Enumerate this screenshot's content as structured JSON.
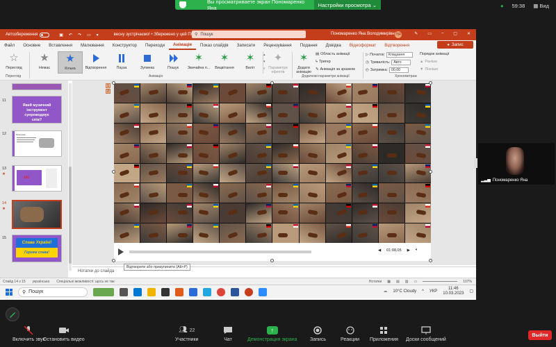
{
  "zoom": {
    "share_banner": "Вы просматриваете экран Пономаренко Яна",
    "view_options": "Настройки просмотра",
    "clock": "59:38",
    "view": "Вид",
    "participant_name": "Пономаренко Яна",
    "toolbar": {
      "mute": "Включить звук",
      "video": "Остановить видео",
      "participants": "Участники",
      "participants_count": "22",
      "chat": "Чат",
      "share": "Демонстрация экрана",
      "record": "Запись",
      "reactions": "Реакции",
      "apps": "Приложения",
      "whiteboards": "Доски сообщений",
      "leave": "Выйти"
    }
  },
  "ppt": {
    "autosave": "Автозбереження",
    "doc_title": "весну зустрічаємо! • Збережено у цей ПК",
    "search_placeholder": "Пошук",
    "user": "Пономаренко Яна Володимирівна",
    "initials": "ПЯ",
    "tabs": [
      "Файл",
      "Основне",
      "Вставлення",
      "Малювання",
      "Конструктор",
      "Переходи",
      "Анімація",
      "Показ слайдів",
      "Записати",
      "Рецензування",
      "Подання",
      "Довідка",
      "Відеоформат",
      "Відтворення"
    ],
    "share_btn": "Запис",
    "ribbon": {
      "preview": "Перегляд",
      "preview_group": "Перегляд",
      "animations": [
        {
          "label": "Немає",
          "kind": "none"
        },
        {
          "label": "Кілька",
          "kind": "sel"
        },
        {
          "label": "Відтворення",
          "kind": "play"
        },
        {
          "label": "Пауза",
          "kind": "pause"
        },
        {
          "label": "Зупинка",
          "kind": "stop"
        },
        {
          "label": "Пошук",
          "kind": "seek"
        },
        {
          "label": "Звичайна п...",
          "kind": "star"
        },
        {
          "label": "Вицвітання",
          "kind": "star"
        },
        {
          "label": "Виліт",
          "kind": "star"
        }
      ],
      "effect_params": "Параметри ефектів",
      "anim_group": "Анімація",
      "add_anim": "Додати анімацію",
      "anim_pane": "Область анімації",
      "trigger": "Тригер",
      "anim_painter": "Анімація за зразком",
      "adv_group": "Додаткові параметри анімації",
      "start_label": "Початок:",
      "start_val": "Клацання",
      "duration_label": "Тривалість:",
      "duration_val": "Авто",
      "delay_label": "Затримка:",
      "delay_val": "00,00",
      "reorder": "Порядок анімації",
      "earlier": "Раніше",
      "later": "Пізніше",
      "timing_group": "Хронометраж"
    },
    "slides": [
      {
        "num": "11",
        "text": "Який музичний інструмент супроводжує спів?"
      },
      {
        "num": "12",
        "text": "Пролунає..."
      },
      {
        "num": "13",
        "text": "141"
      },
      {
        "num": "14",
        "text": ""
      },
      {
        "num": "15",
        "text": "Слава Україні!",
        "text2": "Героям слава!"
      }
    ],
    "media_time": "01:08,05",
    "tooltip": "Відтворити або призупинити (Alt+P)",
    "notes": "Нотатки до слайда",
    "status": {
      "slide": "Слайд 14 з 15",
      "lang": "українська",
      "accessibility": "Спеціальні можливості: щось не так",
      "notes": "Нотатки",
      "zoom": "107%"
    }
  },
  "taskbar": {
    "search": "Пошук",
    "weather": "10°C Cloudy",
    "lang": "УКР",
    "time": "11:46",
    "date": "10.03.2023"
  },
  "colors": {
    "ppt_accent": "#c43e1c",
    "zoom_green": "#2bb24c",
    "leave_red": "#e02828"
  }
}
